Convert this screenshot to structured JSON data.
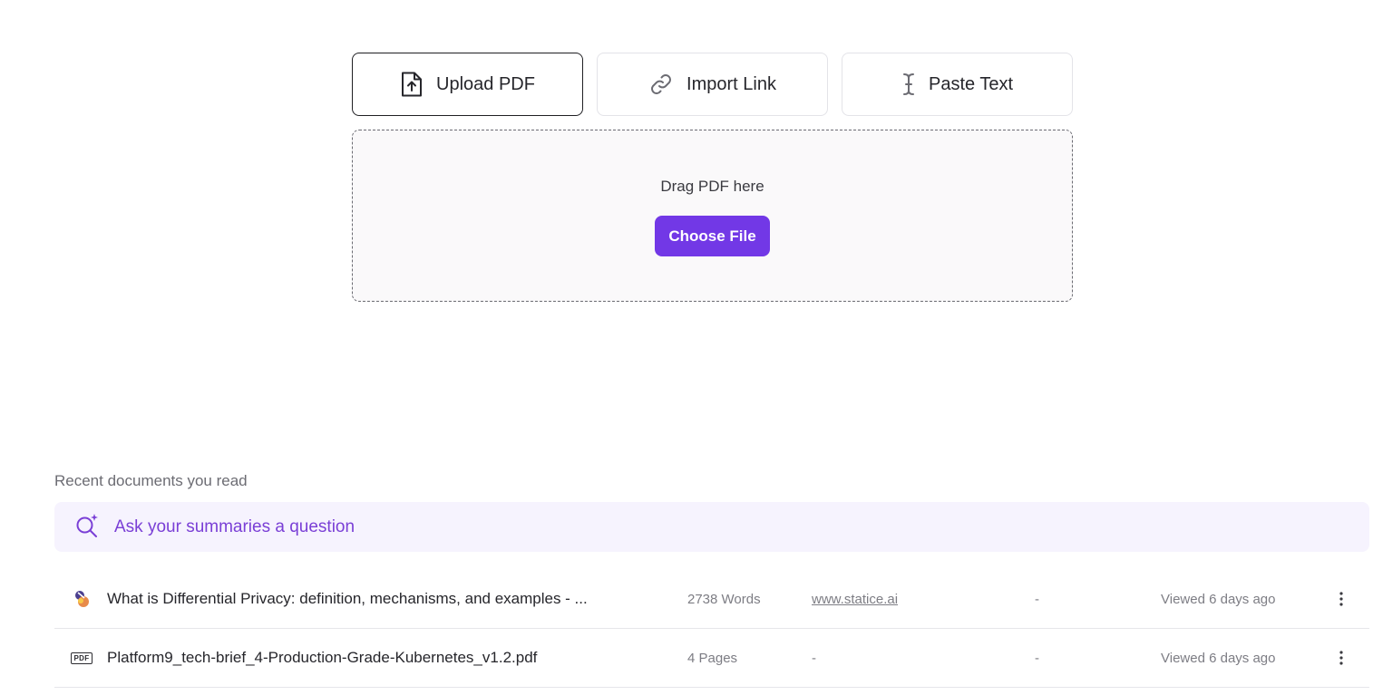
{
  "mode_tabs": [
    {
      "label": "Upload PDF",
      "icon": "upload-file-icon",
      "active": true
    },
    {
      "label": "Import Link",
      "icon": "link-icon",
      "active": false
    },
    {
      "label": "Paste Text",
      "icon": "text-cursor-icon",
      "active": false
    }
  ],
  "dropzone": {
    "text": "Drag PDF here",
    "button_label": "Choose File"
  },
  "recent": {
    "title": "Recent documents you read",
    "ask_placeholder": "Ask your summaries a question",
    "documents": [
      {
        "icon": "site-favicon-icon",
        "title": "What is Differential Privacy: definition, mechanisms, and examples - ...",
        "count": "2738 Words",
        "source": "www.statice.ai",
        "dash": "-",
        "viewed": "Viewed 6 days ago"
      },
      {
        "icon": "pdf-file-icon",
        "icon_text": "PDF",
        "title": "Platform9_tech-brief_4-Production-Grade-Kubernetes_v1.2.pdf",
        "count": "4 Pages",
        "source": "-",
        "dash": "-",
        "viewed": "Viewed 6 days ago"
      }
    ]
  },
  "colors": {
    "accent": "#7238e6",
    "ask_bar_bg": "#f6f3fe",
    "ask_text": "#7a3fd6"
  }
}
